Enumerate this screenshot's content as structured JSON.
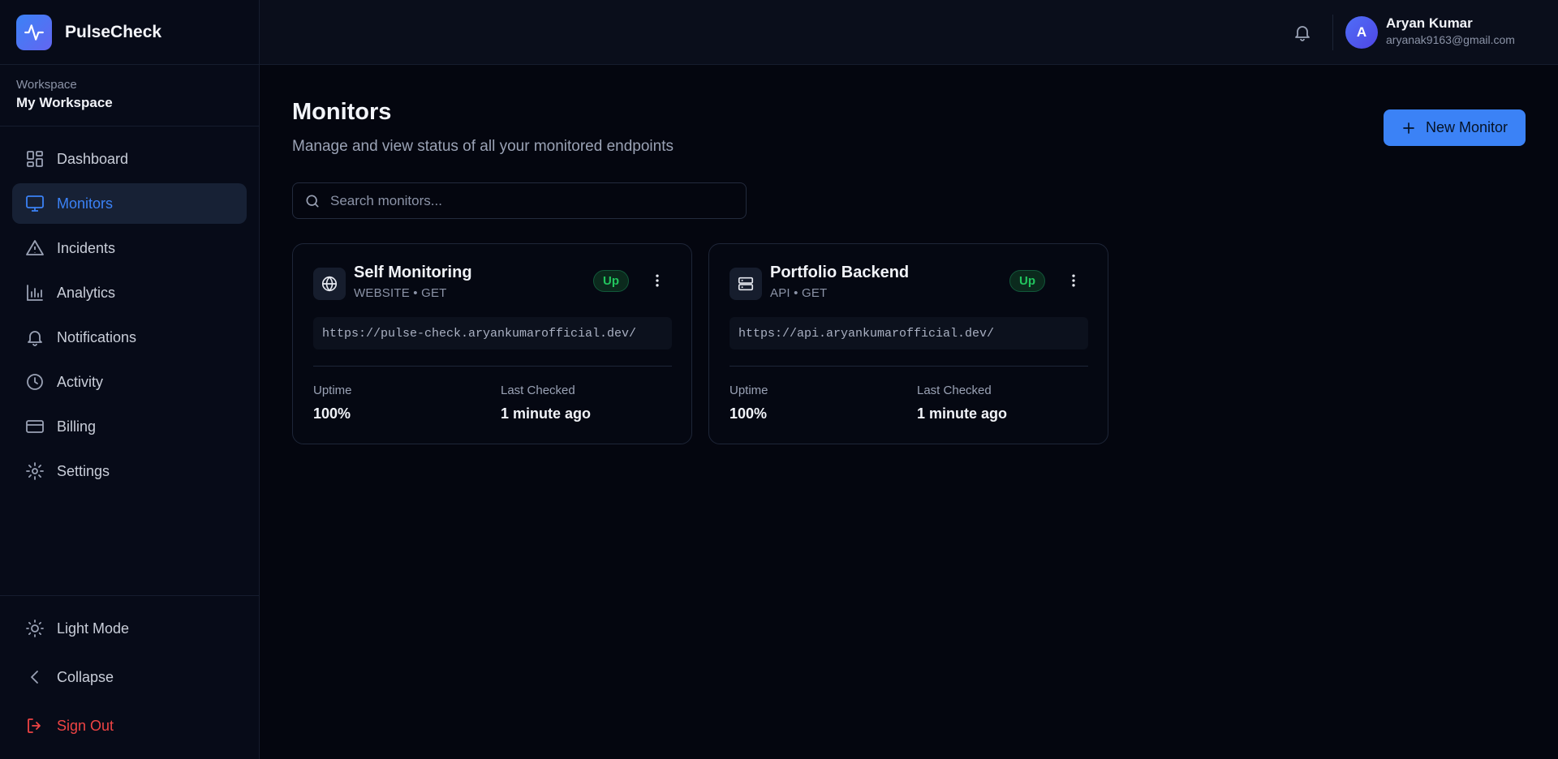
{
  "brand": {
    "name": "PulseCheck"
  },
  "workspace": {
    "label": "Workspace",
    "name": "My Workspace"
  },
  "nav": {
    "items": [
      {
        "label": "Dashboard",
        "icon": "dashboard-icon"
      },
      {
        "label": "Monitors",
        "icon": "monitor-icon",
        "active": true
      },
      {
        "label": "Incidents",
        "icon": "alert-triangle-icon"
      },
      {
        "label": "Analytics",
        "icon": "bar-chart-icon"
      },
      {
        "label": "Notifications",
        "icon": "bell-icon"
      },
      {
        "label": "Activity",
        "icon": "clock-icon"
      },
      {
        "label": "Billing",
        "icon": "credit-card-icon"
      },
      {
        "label": "Settings",
        "icon": "gear-icon"
      }
    ]
  },
  "sidebar_bottom": {
    "light_mode": "Light Mode",
    "collapse": "Collapse",
    "sign_out": "Sign Out"
  },
  "user": {
    "initial": "A",
    "name": "Aryan Kumar",
    "email": "aryanak9163@gmail.com"
  },
  "page": {
    "title": "Monitors",
    "subtitle": "Manage and view status of all your monitored endpoints",
    "new_button": "New Monitor",
    "search_placeholder": "Search monitors..."
  },
  "monitors": [
    {
      "name": "Self Monitoring",
      "type": "WEBSITE • GET",
      "status": "Up",
      "url": "https://pulse-check.aryankumarofficial.dev/",
      "uptime_label": "Uptime",
      "uptime": "100%",
      "last_checked_label": "Last Checked",
      "last_checked": "1 minute ago",
      "icon": "globe-icon"
    },
    {
      "name": "Portfolio Backend",
      "type": "API • GET",
      "status": "Up",
      "url": "https://api.aryankumarofficial.dev/",
      "uptime_label": "Uptime",
      "uptime": "100%",
      "last_checked_label": "Last Checked",
      "last_checked": "1 minute ago",
      "icon": "server-icon"
    }
  ],
  "colors": {
    "accent": "#3b82f6",
    "background": "#04060f",
    "sidebar": "#070b18",
    "status_up": "#22c55e",
    "danger": "#ef4444"
  }
}
